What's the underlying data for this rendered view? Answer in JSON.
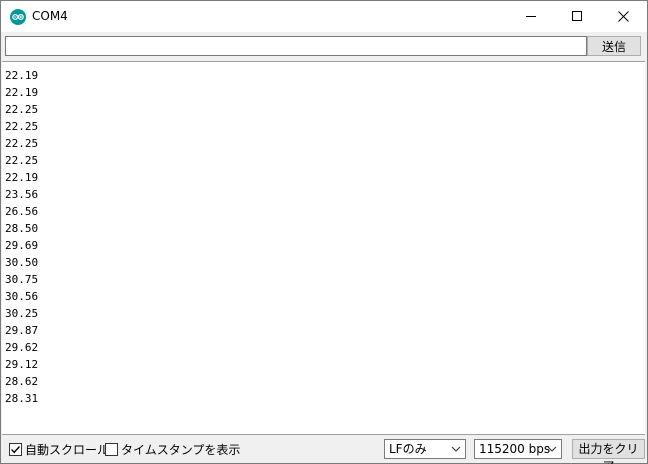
{
  "window": {
    "title": "COM4"
  },
  "send": {
    "input_value": "",
    "button_label": "送信"
  },
  "output": {
    "lines": [
      "22.19",
      "22.19",
      "22.25",
      "22.25",
      "22.25",
      "22.25",
      "22.19",
      "23.56",
      "26.56",
      "28.50",
      "29.69",
      "30.50",
      "30.75",
      "30.56",
      "30.25",
      "29.87",
      "29.62",
      "29.12",
      "28.62",
      "28.31"
    ]
  },
  "bottom": {
    "autoscroll_label": "自動スクロール",
    "autoscroll_checked": true,
    "timestamp_label": "タイムスタンプを表示",
    "timestamp_checked": false,
    "line_ending_selected": "LFのみ",
    "baud_selected": "115200 bps",
    "clear_label": "出力をクリア"
  },
  "colors": {
    "app_icon": "#00979c",
    "background": "#f0f0f0",
    "output_background": "#ffffff"
  },
  "icons": {
    "app": "arduino-icon",
    "minimize": "minimize-icon",
    "maximize": "maximize-icon",
    "close": "close-icon",
    "dropdown": "chevron-down-icon",
    "checkmark": "checkmark-icon"
  }
}
